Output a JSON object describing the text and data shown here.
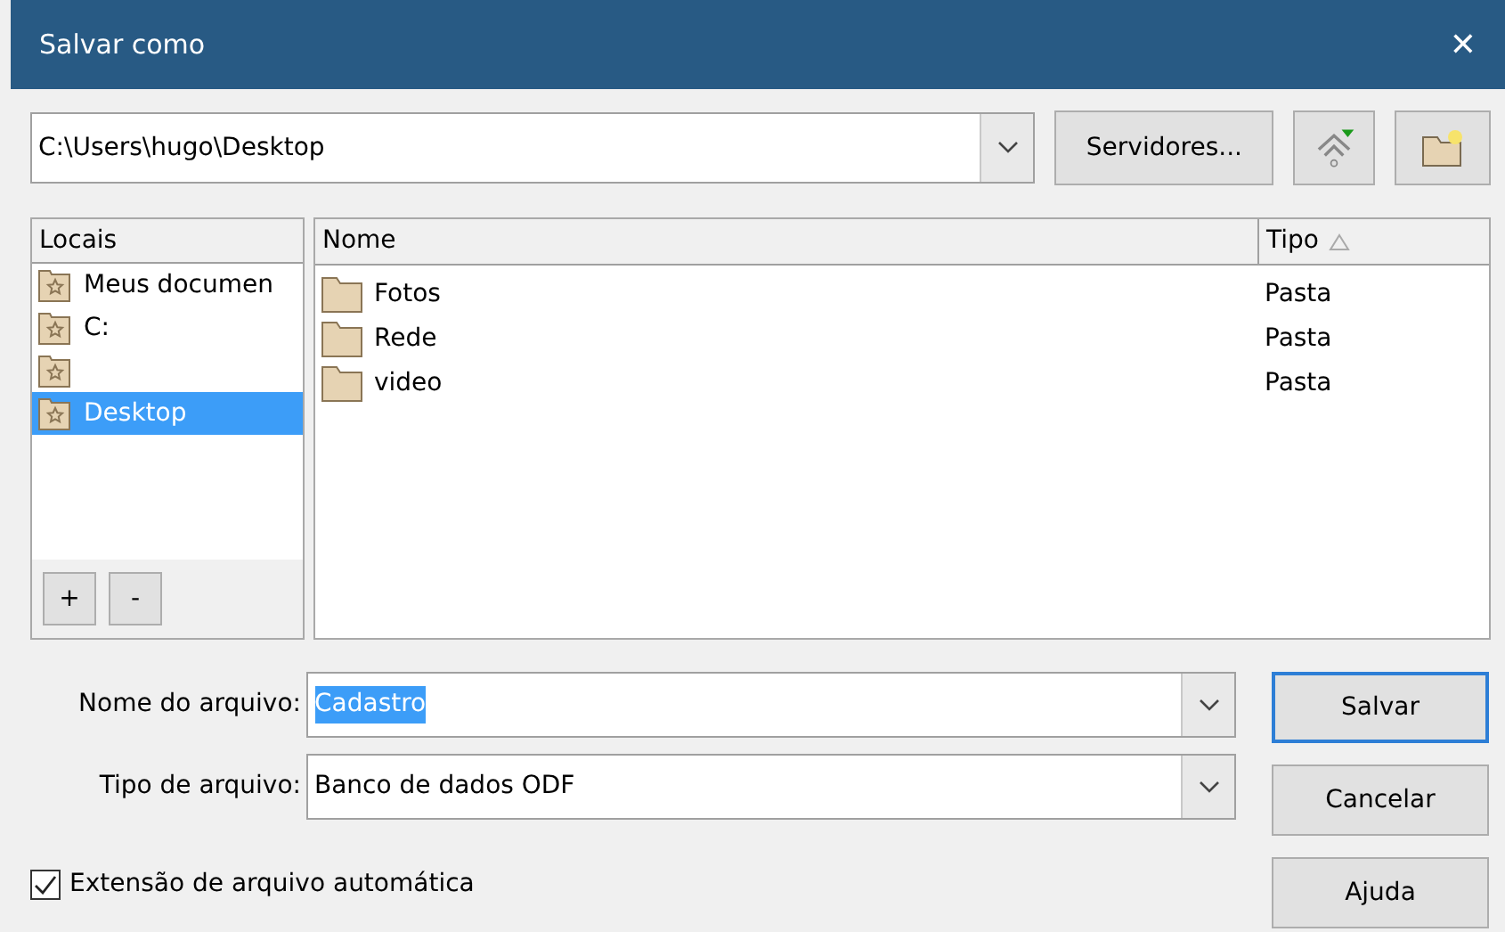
{
  "window": {
    "title": "Salvar como",
    "close": "✕"
  },
  "path": {
    "value": "C:\\Users\\hugo\\Desktop"
  },
  "toolbar": {
    "servers_button": "Servidores..."
  },
  "places": {
    "header": "Locais",
    "items": [
      {
        "label": "Meus documen",
        "selected": false
      },
      {
        "label": "C:",
        "selected": false
      },
      {
        "selected": false
      },
      {
        "label": "Desktop",
        "selected": true
      }
    ],
    "add_button": "+",
    "remove_button": "-"
  },
  "files": {
    "columns": [
      {
        "label": "Nome",
        "sorted": false
      },
      {
        "label": "Tipo",
        "sorted": true
      }
    ],
    "rows": [
      {
        "name": "Fotos",
        "type": "Pasta"
      },
      {
        "name": "Rede",
        "type": "Pasta"
      },
      {
        "name": "video",
        "type": "Pasta"
      }
    ]
  },
  "filename": {
    "label": "Nome do arquivo:",
    "value": "Cadastro",
    "selected": true
  },
  "filetype": {
    "label": "Tipo de arquivo:",
    "value": "Banco de dados ODF"
  },
  "auto_extension": {
    "label": "Extensão de arquivo automática",
    "checked": true
  },
  "buttons": [
    {
      "label": "Salvar",
      "default": true
    },
    {
      "label": "Cancelar",
      "default": false
    },
    {
      "label": "Ajuda",
      "default": false
    }
  ]
}
